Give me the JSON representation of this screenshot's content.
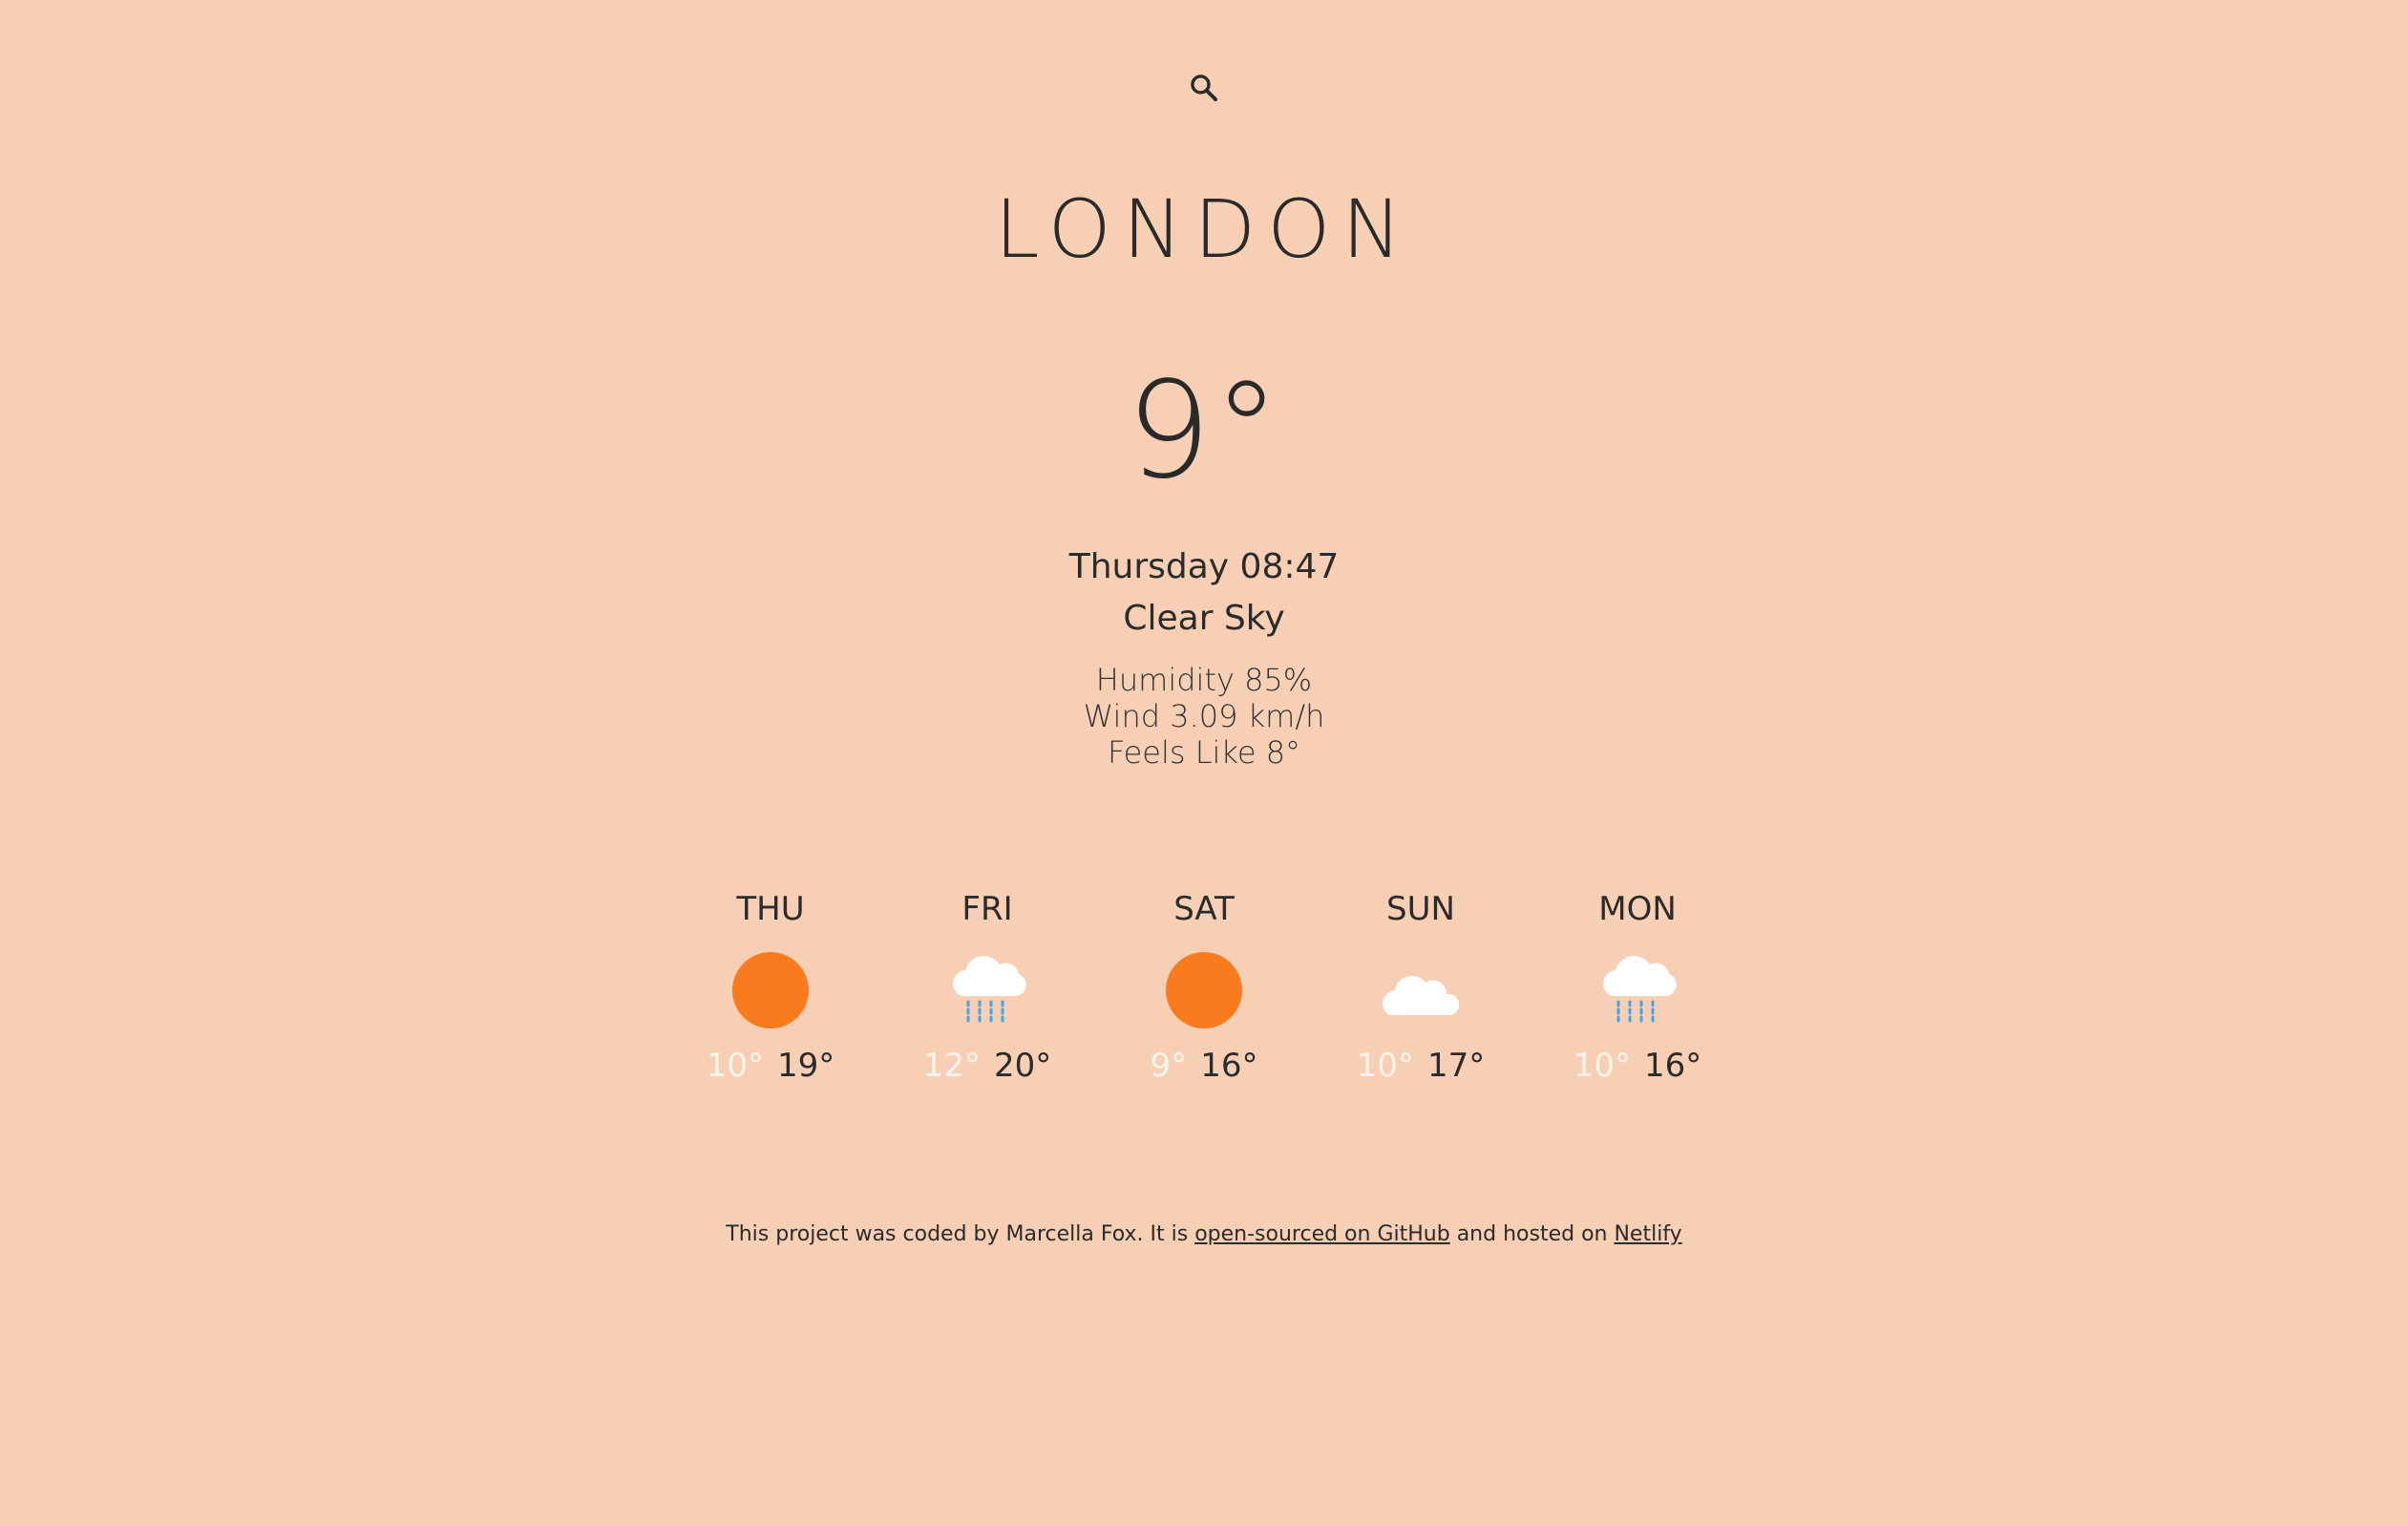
{
  "search": {
    "icon": "search-icon"
  },
  "city": "LONDON",
  "current": {
    "temperature": "9°",
    "datetime": "Thursday 08:47",
    "condition": "Clear Sky",
    "humidity": "Humidity 85%",
    "wind": "Wind 3.09 km/h",
    "feels_like": "Feels Like 8°"
  },
  "forecast": [
    {
      "day": "THU",
      "icon": "sun-icon",
      "min": "10°",
      "max": "19°"
    },
    {
      "day": "FRI",
      "icon": "rain-cloud-icon",
      "min": "12°",
      "max": "20°"
    },
    {
      "day": "SAT",
      "icon": "sun-icon",
      "min": "9°",
      "max": "16°"
    },
    {
      "day": "SUN",
      "icon": "cloud-icon",
      "min": "10°",
      "max": "17°"
    },
    {
      "day": "MON",
      "icon": "rain-cloud-icon",
      "min": "10°",
      "max": "16°"
    }
  ],
  "footer": {
    "text_before": "This project was coded by Marcella Fox. It is ",
    "github_link": "open-sourced on GitHub",
    "text_middle": " and hosted on ",
    "netlify_link": "Netlify"
  },
  "colors": {
    "background": "#f7cfb5",
    "sun": "#fa7a1e",
    "rain": "#4aa3df",
    "cloud": "#ffffff",
    "min_temp": "#fff4ec"
  }
}
